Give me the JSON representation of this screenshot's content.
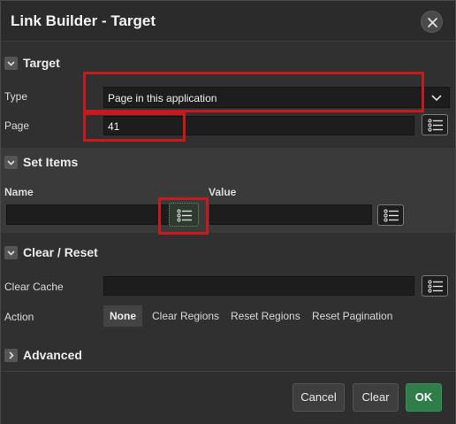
{
  "dialog": {
    "title": "Link Builder - Target"
  },
  "sections": {
    "target": {
      "label": "Target"
    },
    "set_items": {
      "label": "Set Items"
    },
    "clear_reset": {
      "label": "Clear / Reset"
    },
    "advanced": {
      "label": "Advanced"
    }
  },
  "target": {
    "type_label": "Type",
    "type_value": "Page in this application",
    "page_label": "Page",
    "page_value": "41"
  },
  "set_items": {
    "name_label": "Name",
    "value_label": "Value",
    "name_value": "",
    "value_value": ""
  },
  "clear_reset": {
    "clear_cache_label": "Clear Cache",
    "clear_cache_value": "",
    "action_label": "Action",
    "actions": [
      "None",
      "Clear Regions",
      "Reset Regions",
      "Reset Pagination"
    ],
    "selected_action": "None"
  },
  "footer": {
    "cancel": "Cancel",
    "clear": "Clear",
    "ok": "OK"
  },
  "colors": {
    "ok_button": "#2f7d48",
    "highlight": "#c8191c"
  },
  "icons": [
    "close-icon",
    "chevron-down-icon",
    "chevron-right-icon",
    "list-icon"
  ]
}
